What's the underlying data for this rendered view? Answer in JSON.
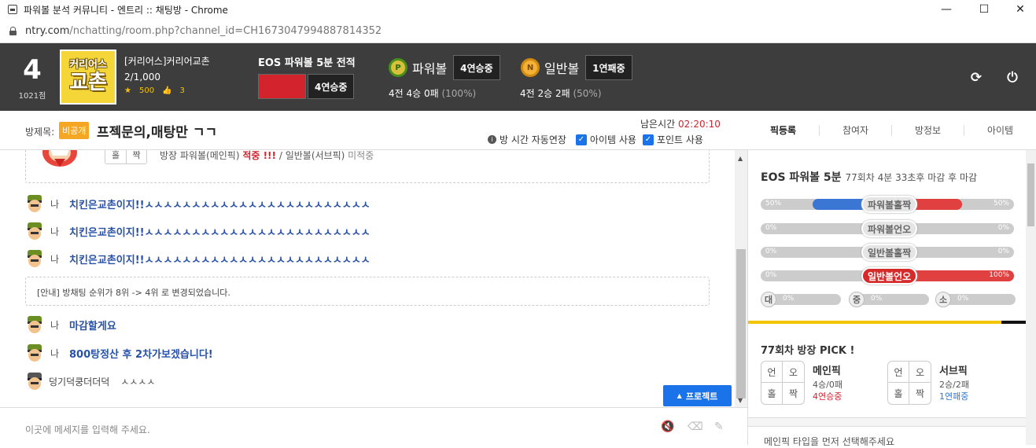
{
  "window": {
    "title": "파워볼 분석 커뮤니티 - 엔트리 :: 채팅방 - Chrome",
    "min": "—",
    "max": "☐",
    "close": "✕"
  },
  "address": {
    "host": "ntry.com",
    "path": "/nchatting/room.php?channel_id=CH1673047994887814352"
  },
  "header": {
    "rank": "4",
    "points": "1021점",
    "logo_line1": "커리어스",
    "logo_line2": "교촌",
    "room_name": "[커리어스]커리어교촌",
    "members": "2/1,000",
    "stars": "500",
    "likes": "3",
    "eos_title": "EOS 파워볼 5분 전적",
    "eos_record": "4승 0패",
    "eos_streak": "4연승중",
    "powerball": {
      "icon": "P",
      "name": "파워볼",
      "streak": "4연승중",
      "record": "4전 4승 0패",
      "pct": "(100%)"
    },
    "normalball": {
      "icon": "N",
      "name": "일반볼",
      "streak": "1연패중",
      "record": "4전 2승 2패",
      "pct": "(50%)"
    }
  },
  "roombar": {
    "label": "방제목:",
    "private_badge": "비공개",
    "title": "프젝문의,매탕만 ㄱㄱ",
    "remain_label": "남은시간",
    "remain_time": "02:20:10",
    "auto_extend": "방 시간 자동연장",
    "item_use": "아이템 사용",
    "point_use": "포인트 사용"
  },
  "tabs": [
    "픽등록",
    "참여자",
    "방정보",
    "아이템"
  ],
  "chat": {
    "top_notice": {
      "odd": "홀",
      "even": "짝",
      "text_prefix": "방장 파워볼(메인픽)",
      "hit": "적중 !!!",
      "text_mid": "/ 일반볼(서브픽)",
      "miss": "미적중"
    },
    "messages": [
      {
        "name": "나",
        "text": "치킨은교촌이지!!ㅅㅅㅅㅅㅅㅅㅅㅅㅅㅅㅅㅅㅅㅅㅅㅅㅅㅅㅅㅅㅅㅅㅅㅅ"
      },
      {
        "name": "나",
        "text": "치킨은교촌이지!!ㅅㅅㅅㅅㅅㅅㅅㅅㅅㅅㅅㅅㅅㅅㅅㅅㅅㅅㅅㅅㅅㅅㅅㅅ"
      },
      {
        "name": "나",
        "text": "치킨은교촌이지!!ㅅㅅㅅㅅㅅㅅㅅㅅㅅㅅㅅㅅㅅㅅㅅㅅㅅㅅㅅㅅㅅㅅㅅㅅ"
      }
    ],
    "rank_notice": "[안내] 방채팅 순위가 8위 -> 4위 로 변경되었습니다.",
    "messages2": [
      {
        "name": "나",
        "text": "마감할게요"
      },
      {
        "name": "나",
        "text": "800탕정산 후 2차가보겠습니다!"
      }
    ],
    "other": {
      "name": "덩기덕쿵더더덕",
      "text": "ㅅㅅㅅㅅ"
    },
    "project_button": "프로젝트",
    "input_placeholder": "이곳에 메세지를 입력해 주세요."
  },
  "side": {
    "title": "EOS 파워볼 5분",
    "round_info": "77회차 4분 33초후 마감 후 마감",
    "votes": [
      {
        "label": "파워볼홀짝",
        "left_pct": "50%",
        "right_pct": "50%",
        "left": 0.5,
        "selected": false
      },
      {
        "label": "파워볼언오",
        "left_pct": "0%",
        "right_pct": "0%",
        "left": 0,
        "selected": false
      },
      {
        "label": "일반볼홀짝",
        "left_pct": "0%",
        "right_pct": "0%",
        "left": 0,
        "selected": false
      },
      {
        "label": "일반볼언오",
        "left_pct": "0%",
        "right_pct": "100%",
        "left": 0,
        "selected": true
      }
    ],
    "sizes": [
      {
        "label": "대",
        "pct": "0%"
      },
      {
        "label": "중",
        "pct": "0%"
      },
      {
        "label": "소",
        "pct": "0%"
      }
    ],
    "pick_title": "77회차 방장 PICK !",
    "main": {
      "title": "메인픽",
      "cells": [
        "언",
        "오",
        "홀",
        "짝"
      ],
      "record": "4승/0패",
      "streak": "4연승중"
    },
    "sub": {
      "title": "서브픽",
      "cells": [
        "언",
        "오",
        "홀",
        "짝"
      ],
      "record": "2승/2패",
      "streak": "1연패중"
    },
    "note": "메인픽 타입을 먼저 선택해주세요"
  },
  "colors": {
    "header_bg": "#3d3d3d",
    "accent_red": "#d3232d",
    "accent_blue": "#1a73e8",
    "private_orange": "#f5a623"
  }
}
